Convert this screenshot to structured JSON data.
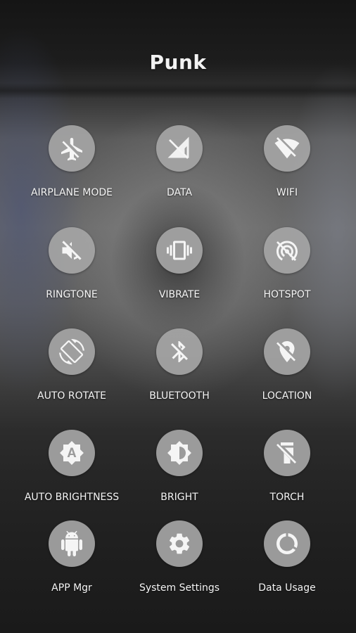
{
  "app": {
    "title": "Punk"
  },
  "colors": {
    "icon_circle": "#a5a5a5",
    "icon_glyph": "#f5f5f5",
    "label_text": "#f5f5f5"
  },
  "toggles": [
    {
      "label": "AIRPLANE MODE",
      "icon": "airplane-off-icon"
    },
    {
      "label": "DATA",
      "icon": "mobile-data-off-icon"
    },
    {
      "label": "WIFI",
      "icon": "wifi-off-icon"
    },
    {
      "label": "RINGTONE",
      "icon": "volume-off-icon"
    },
    {
      "label": "VIBRATE",
      "icon": "vibrate-icon"
    },
    {
      "label": "HOTSPOT",
      "icon": "hotspot-off-icon"
    },
    {
      "label": "AUTO ROTATE",
      "icon": "auto-rotate-icon"
    },
    {
      "label": "BLUETOOTH",
      "icon": "bluetooth-off-icon"
    },
    {
      "label": "LOCATION",
      "icon": "location-off-icon"
    },
    {
      "label": "AUTO BRIGHTNESS",
      "icon": "auto-brightness-icon"
    },
    {
      "label": "BRIGHT",
      "icon": "brightness-icon"
    },
    {
      "label": "TORCH",
      "icon": "torch-off-icon"
    },
    {
      "label": "APP Mgr",
      "icon": "android-icon"
    },
    {
      "label": "System Settings",
      "icon": "gear-icon"
    },
    {
      "label": "Data Usage",
      "icon": "data-usage-icon"
    }
  ]
}
